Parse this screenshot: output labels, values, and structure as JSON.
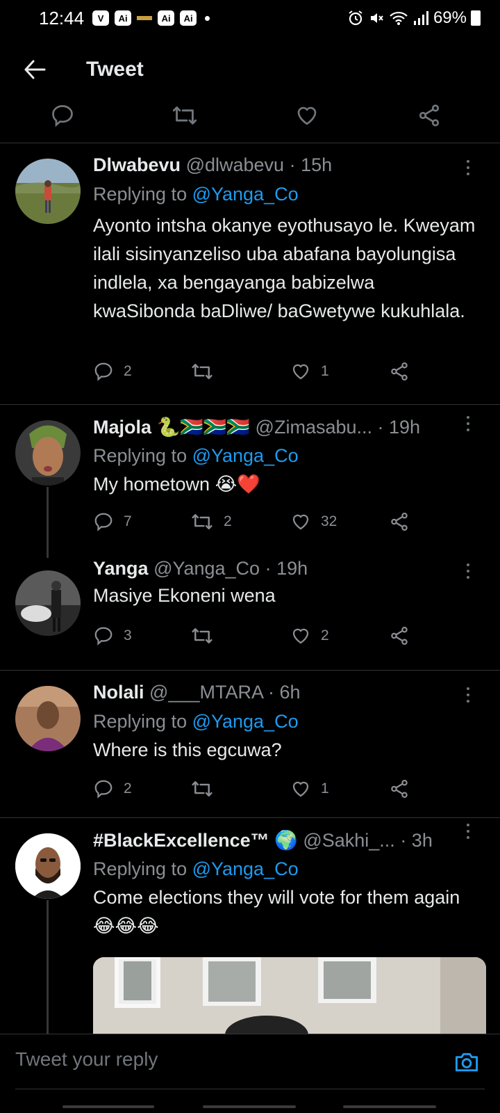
{
  "status_bar": {
    "time": "12:44",
    "badges": [
      "V",
      "Ai",
      "Ai",
      "Ai"
    ],
    "battery_percent": "69%"
  },
  "header": {
    "title": "Tweet"
  },
  "tweets": [
    {
      "name": "Dlwabevu",
      "handle": "@dlwabevu",
      "time": "· 15h",
      "replying_prefix": "Replying to ",
      "replying_to": "@Yanga_Co",
      "text": "Ayonto intsha okanye eyothusayo le. Kweyam ilali sisinyanzeliso uba abafana bayolungisa indlela, xa bengayanga babizelwa kwaSibonda baDliwe/ baGwetywe kukuhlala.",
      "replies": "2",
      "retweets": "",
      "likes": "1"
    },
    {
      "name": "Majola",
      "name_emoji": "🐍🇿🇦🇿🇦🇿🇦",
      "handle": "@Zimasabu...",
      "time": "· 19h",
      "replying_prefix": "Replying to ",
      "replying_to": "@Yanga_Co",
      "text": "My hometown 😭❤️",
      "replies": "7",
      "retweets": "2",
      "likes": "32"
    },
    {
      "name": "Yanga",
      "handle": "@Yanga_Co",
      "time": "· 19h",
      "text": "Masiye Ekoneni wena",
      "replies": "3",
      "retweets": "",
      "likes": "2"
    },
    {
      "name": "Nolali",
      "handle": "@___MTARA",
      "time": "· 6h",
      "replying_prefix": "Replying to ",
      "replying_to": "@Yanga_Co",
      "text": "Where is this egcuwa?",
      "replies": "2",
      "retweets": "",
      "likes": "1"
    },
    {
      "name": "#BlackExcellence™",
      "name_emoji": "🌍",
      "handle": "@Sakhi_...",
      "time": "· 3h",
      "replying_prefix": "Replying to ",
      "replying_to": "@Yanga_Co",
      "text": "Come elections they will vote for them again 😂😂😂"
    }
  ],
  "reply_bar": {
    "placeholder": "Tweet your reply"
  },
  "colors": {
    "background": "#000000",
    "link_blue": "#1d9bf0",
    "muted_text": "#8b8f94",
    "divider": "#2f3336"
  }
}
